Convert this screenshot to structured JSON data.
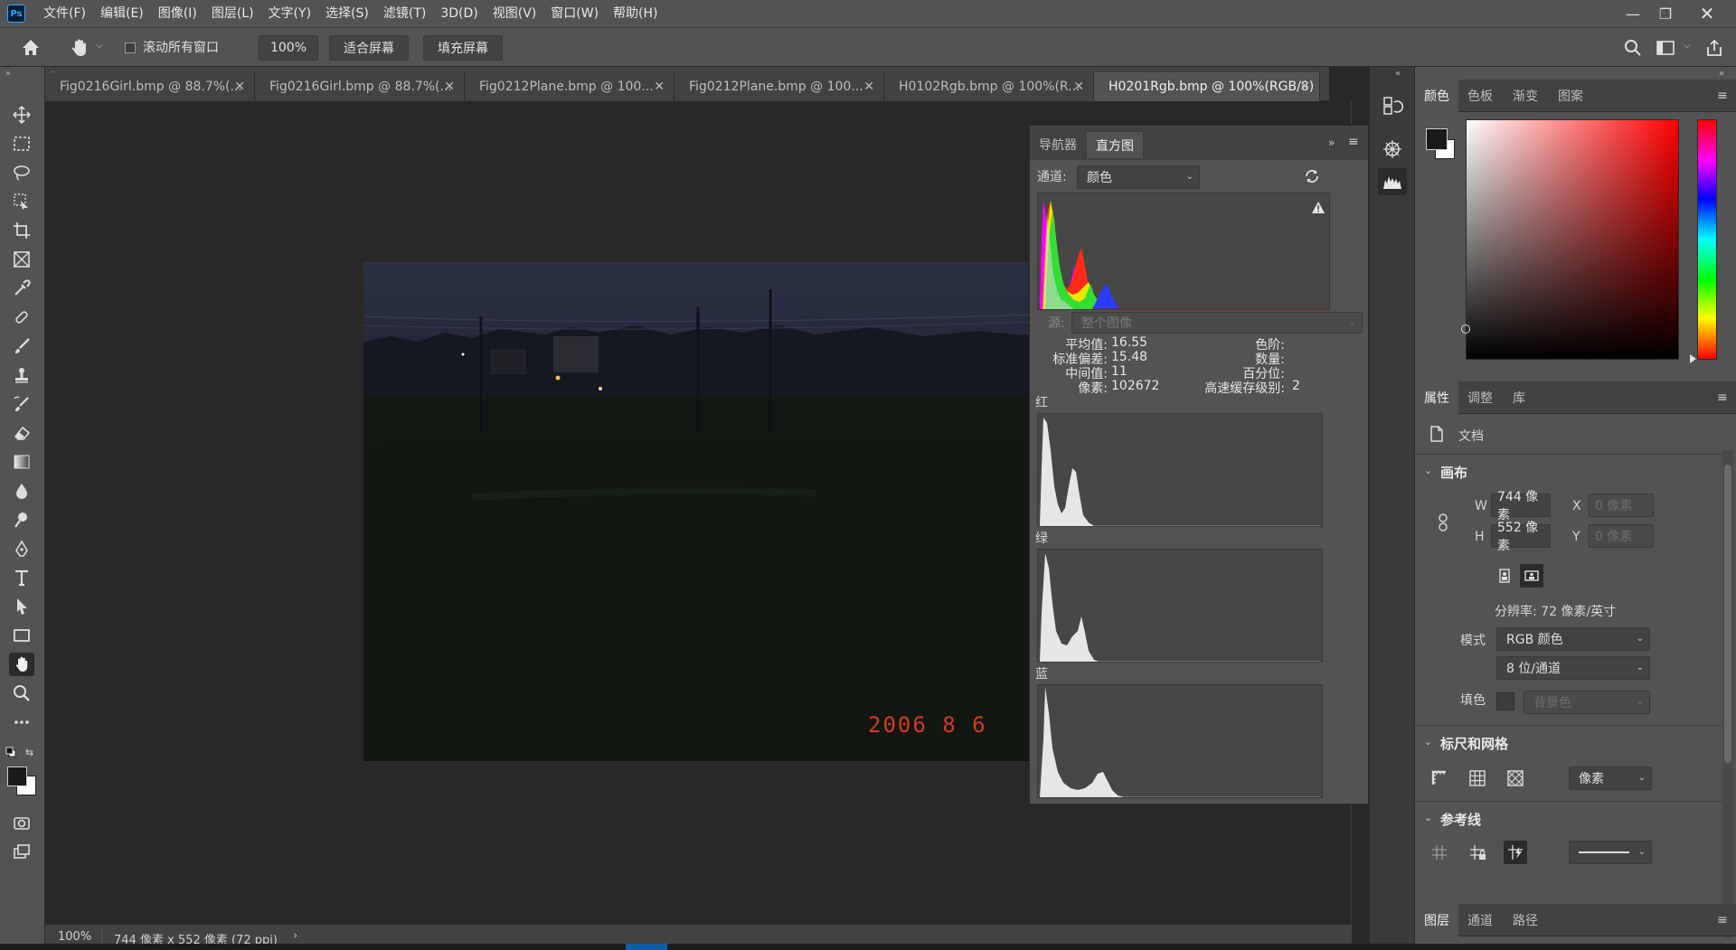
{
  "menubar": {
    "logo": "Ps",
    "items": [
      "文件(F)",
      "编辑(E)",
      "图像(I)",
      "图层(L)",
      "文字(Y)",
      "选择(S)",
      "滤镜(T)",
      "3D(D)",
      "视图(V)",
      "窗口(W)",
      "帮助(H)"
    ]
  },
  "options": {
    "scroll_all_label": "滚动所有窗口",
    "zoom_value": "100%",
    "fit_screen": "适合屏幕",
    "fill_screen": "填充屏幕"
  },
  "tabs": [
    {
      "label": "Fig0216Girl.bmp @ 88.7%(..."
    },
    {
      "label": "Fig0216Girl.bmp @ 88.7%(..."
    },
    {
      "label": "Fig0212Plane.bmp @ 100..."
    },
    {
      "label": "Fig0212Plane.bmp @ 100..."
    },
    {
      "label": "H0102Rgb.bmp @ 100%(R..."
    },
    {
      "label": "H0201Rgb.bmp @ 100%(RGB/8)"
    }
  ],
  "photo": {
    "date_stamp": "2006  8  6"
  },
  "histogram_panel": {
    "tab_navigator": "导航器",
    "tab_histogram": "直方图",
    "channel_label": "通道:",
    "channel_value": "颜色",
    "source_label": "源:",
    "source_value": "整个图像",
    "stats": {
      "mean_label": "平均值:",
      "mean_value": "16.55",
      "stddev_label": "标准偏差:",
      "stddev_value": "15.48",
      "median_label": "中间值:",
      "median_value": "11",
      "pixels_label": "像素:",
      "pixels_value": "102672",
      "level_label": "色阶:",
      "count_label": "数量:",
      "percentile_label": "百分位:",
      "cache_label": "高速缓存级别:",
      "cache_value": "2"
    },
    "red_label": "红",
    "green_label": "绿",
    "blue_label": "蓝"
  },
  "color_panel": {
    "tabs": [
      "颜色",
      "色板",
      "渐变",
      "图案"
    ],
    "foreground": "#1a1a1a",
    "background": "#ffffff",
    "hue": "#ff0000"
  },
  "properties_panel": {
    "tabs": [
      "属性",
      "调整",
      "库"
    ],
    "doc_label": "文档",
    "canvas_title": "画布",
    "w_label": "W",
    "w_value": "744 像素",
    "h_label": "H",
    "h_value": "552 像素",
    "x_label": "X",
    "x_placeholder": "0 像素",
    "y_label": "Y",
    "y_placeholder": "0 像素",
    "resolution": "分辨率: 72 像素/英寸",
    "mode_label": "模式",
    "mode_value": "RGB 颜色",
    "depth_value": "8 位/通道",
    "fill_label": "填色",
    "fill_value": "背景色",
    "rulers_title": "标尺和网格",
    "units_value": "像素",
    "guides_title": "参考线"
  },
  "layers_tabs": [
    "图层",
    "通道",
    "路径"
  ],
  "status": {
    "zoom": "100%",
    "doc_info": "744 像素 x 552 像素 (72 ppi)"
  }
}
